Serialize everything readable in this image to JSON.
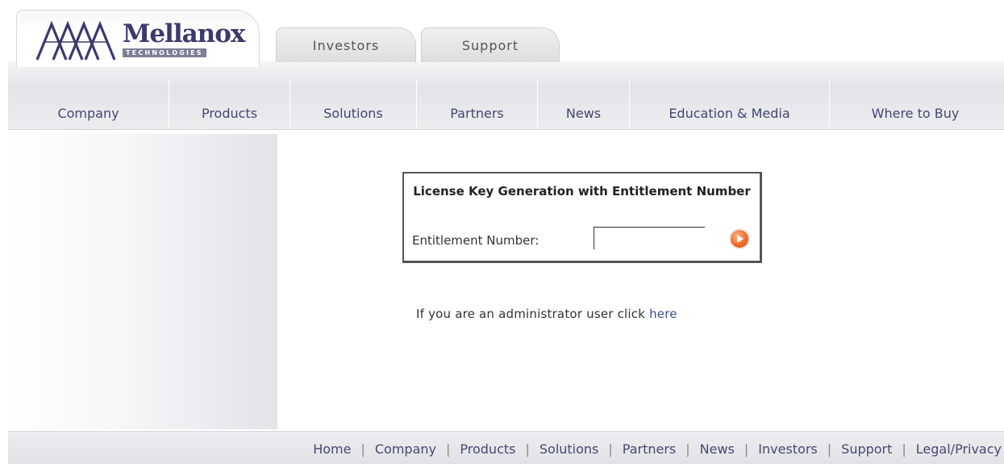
{
  "brand": {
    "name": "Mellanox",
    "tagline": "TECHNOLOGIES"
  },
  "top_tabs": [
    {
      "label": "Investors"
    },
    {
      "label": "Support"
    }
  ],
  "main_nav": [
    {
      "label": "Company"
    },
    {
      "label": "Products"
    },
    {
      "label": "Solutions"
    },
    {
      "label": "Partners"
    },
    {
      "label": "News"
    },
    {
      "label": "Education & Media"
    },
    {
      "label": "Where to Buy"
    }
  ],
  "license_form": {
    "title": "License Key Generation with Entitlement Number",
    "field_label": "Entitlement Number:",
    "field_value": "",
    "submit_icon": "play-arrow-icon"
  },
  "admin_notice": {
    "text": "If you are an administrator user click",
    "link_label": "here"
  },
  "footer_links": [
    {
      "label": "Home"
    },
    {
      "label": "Company"
    },
    {
      "label": "Products"
    },
    {
      "label": "Solutions"
    },
    {
      "label": "Partners"
    },
    {
      "label": "News"
    },
    {
      "label": "Investors"
    },
    {
      "label": "Support"
    },
    {
      "label": "Legal/Privacy"
    }
  ],
  "colors": {
    "nav_text": "#3f4870",
    "link": "#3d4d95",
    "go_button": "#f26a2a",
    "logo": "#3a3a6e"
  }
}
